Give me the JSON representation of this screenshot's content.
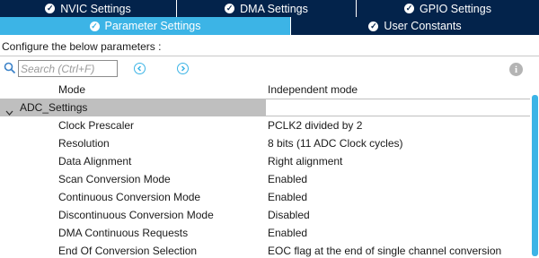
{
  "tabs_row1": [
    {
      "label": "NVIC Settings"
    },
    {
      "label": "DMA Settings"
    },
    {
      "label": "GPIO Settings"
    }
  ],
  "tabs_row2": [
    {
      "label": "Parameter Settings",
      "active": true
    },
    {
      "label": "User Constants",
      "active": false
    }
  ],
  "configure_text": "Configure the below parameters :",
  "search": {
    "placeholder": "Search (Ctrl+F)",
    "value": ""
  },
  "parameters": {
    "mode": {
      "name": "Mode",
      "value": "Independent mode"
    },
    "group_label": "ADC_Settings",
    "items": [
      {
        "name": "Clock Prescaler",
        "value": "PCLK2 divided by 2"
      },
      {
        "name": "Resolution",
        "value": "8 bits (11 ADC Clock cycles)"
      },
      {
        "name": "Data Alignment",
        "value": "Right alignment"
      },
      {
        "name": "Scan Conversion Mode",
        "value": "Enabled"
      },
      {
        "name": "Continuous Conversion Mode",
        "value": "Enabled"
      },
      {
        "name": "Discontinuous Conversion Mode",
        "value": "Disabled"
      },
      {
        "name": "DMA Continuous Requests",
        "value": "Enabled"
      },
      {
        "name": "End Of Conversion Selection",
        "value": "EOC flag at the end of single channel conversion"
      }
    ]
  },
  "colors": {
    "tab_dark": "#03234b",
    "tab_active": "#3cb4e6",
    "group_row": "#bfbfbf"
  }
}
